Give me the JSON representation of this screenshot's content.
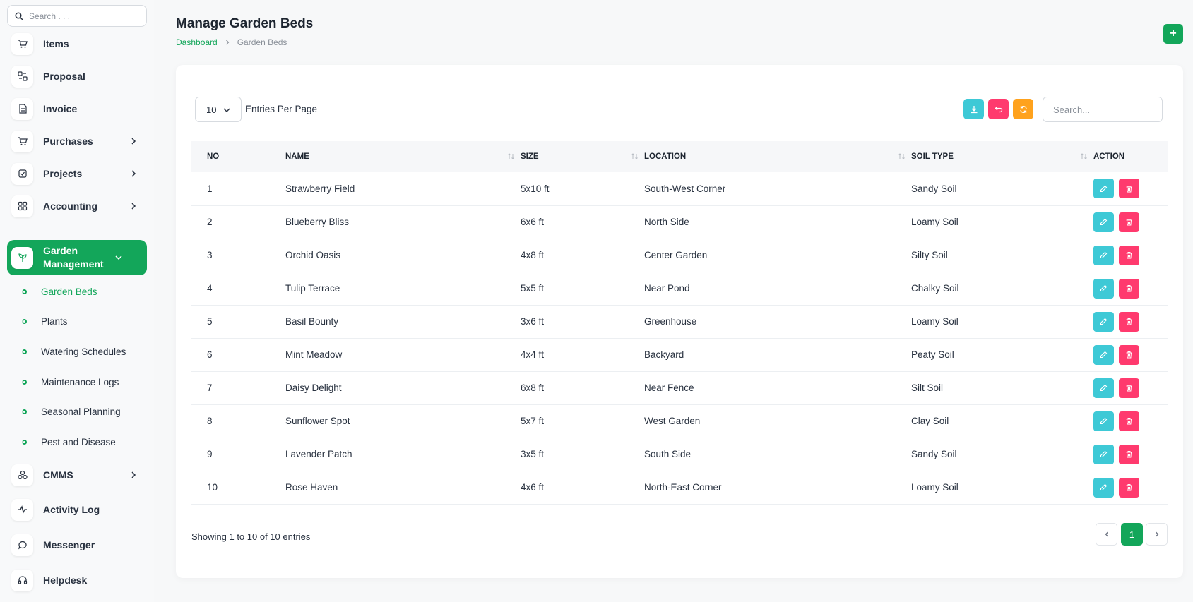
{
  "sidebar": {
    "search_placeholder": "Search . . .",
    "items": [
      {
        "label": "Items"
      },
      {
        "label": "Proposal"
      },
      {
        "label": "Invoice"
      },
      {
        "label": "Purchases"
      },
      {
        "label": "Projects"
      },
      {
        "label": "Accounting"
      },
      {
        "label": "Garden Management"
      },
      {
        "label": "CMMS"
      },
      {
        "label": "Activity Log"
      },
      {
        "label": "Messenger"
      },
      {
        "label": "Helpdesk"
      }
    ],
    "sub_items": [
      {
        "label": "Garden Beds"
      },
      {
        "label": "Plants"
      },
      {
        "label": "Watering Schedules"
      },
      {
        "label": "Maintenance Logs"
      },
      {
        "label": "Seasonal Planning"
      },
      {
        "label": "Pest and Disease"
      }
    ]
  },
  "header": {
    "title": "Manage Garden Beds",
    "breadcrumb": {
      "home": "Dashboard",
      "current": "Garden Beds"
    },
    "add_label": "+"
  },
  "table_controls": {
    "entries_value": "10",
    "entries_label": "Entries Per Page",
    "search_placeholder": "Search..."
  },
  "table": {
    "headers": {
      "no": "NO",
      "name": "NAME",
      "size": "SIZE",
      "location": "LOCATION",
      "soil": "SOIL TYPE",
      "action": "ACTION"
    },
    "rows": [
      {
        "no": "1",
        "name": "Strawberry Field",
        "size": "5x10 ft",
        "location": "South-West Corner",
        "soil": "Sandy Soil"
      },
      {
        "no": "2",
        "name": "Blueberry Bliss",
        "size": "6x6 ft",
        "location": "North Side",
        "soil": "Loamy Soil"
      },
      {
        "no": "3",
        "name": "Orchid Oasis",
        "size": "4x8 ft",
        "location": "Center Garden",
        "soil": "Silty Soil"
      },
      {
        "no": "4",
        "name": "Tulip Terrace",
        "size": "5x5 ft",
        "location": "Near Pond",
        "soil": "Chalky Soil"
      },
      {
        "no": "5",
        "name": "Basil Bounty",
        "size": "3x6 ft",
        "location": "Greenhouse",
        "soil": "Loamy Soil"
      },
      {
        "no": "6",
        "name": "Mint Meadow",
        "size": "4x4 ft",
        "location": "Backyard",
        "soil": "Peaty Soil"
      },
      {
        "no": "7",
        "name": "Daisy Delight",
        "size": "6x8 ft",
        "location": "Near Fence",
        "soil": "Silt Soil"
      },
      {
        "no": "8",
        "name": "Sunflower Spot",
        "size": "5x7 ft",
        "location": "West Garden",
        "soil": "Clay Soil"
      },
      {
        "no": "9",
        "name": "Lavender Patch",
        "size": "3x5 ft",
        "location": "South Side",
        "soil": "Sandy Soil"
      },
      {
        "no": "10",
        "name": "Rose Haven",
        "size": "4x6 ft",
        "location": "North-East Corner",
        "soil": "Loamy Soil"
      }
    ]
  },
  "footer": {
    "showing": "Showing 1 to 10 of 10 entries",
    "current_page": "1"
  },
  "colors": {
    "brand": "#13a65a",
    "edit": "#3ec9d6",
    "delete": "#ff3a6e",
    "download": "#3ec9d6",
    "reset": "#ff3a6e",
    "refresh": "#ffa21d"
  }
}
